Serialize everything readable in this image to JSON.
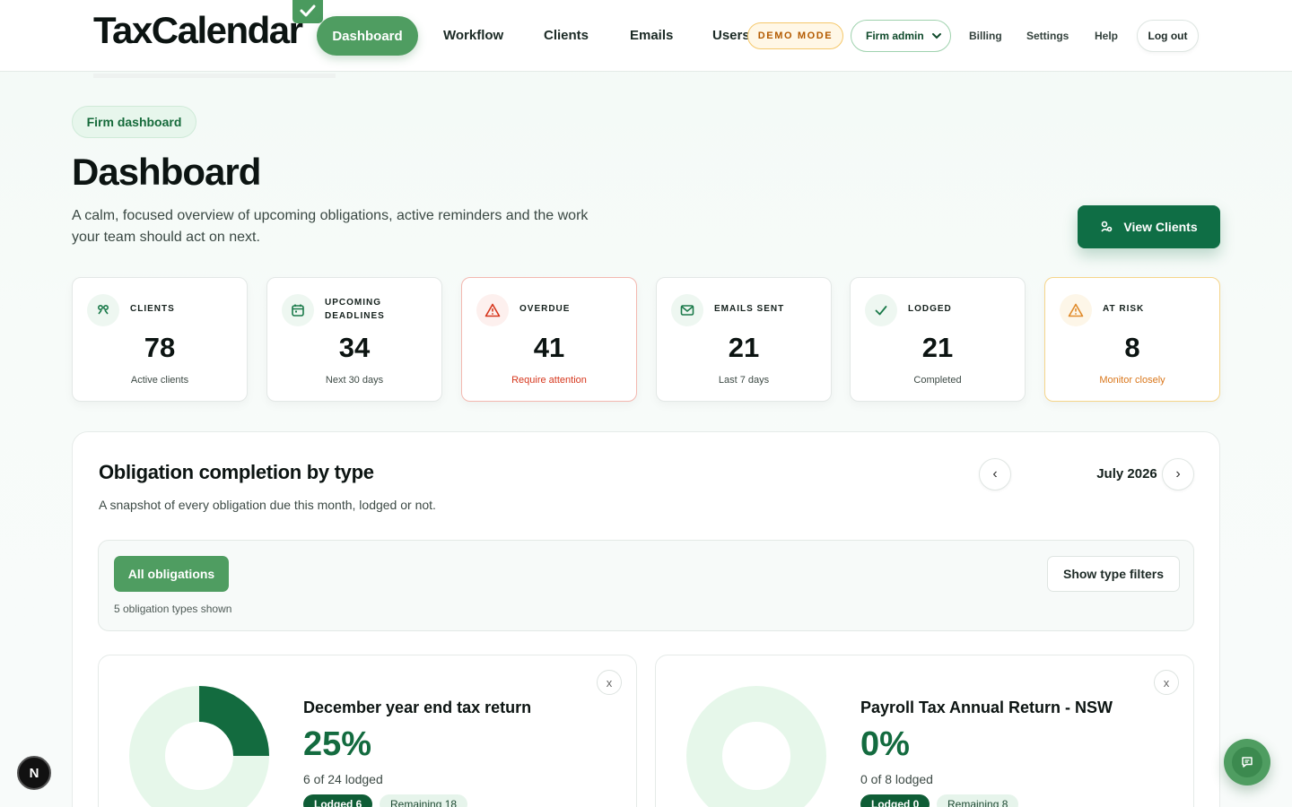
{
  "header": {
    "logo_text": "TaxCalendar",
    "nav": [
      "Dashboard",
      "Workflow",
      "Clients",
      "Emails",
      "Users"
    ],
    "active_nav": "Dashboard",
    "demo_badge": "DEMO MODE",
    "role_select": "Firm admin",
    "links": [
      "Billing",
      "Settings",
      "Help"
    ],
    "logout": "Log out"
  },
  "page": {
    "breadcrumb": "Firm dashboard",
    "title": "Dashboard",
    "subtitle": "A calm, focused overview of upcoming obligations, active reminders and the work your team should act on next.",
    "primary_action": "View Clients"
  },
  "stats": [
    {
      "label": "CLIENTS",
      "value": "78",
      "caption": "Active clients",
      "icon": "clients-icon",
      "tone": "normal"
    },
    {
      "label": "UPCOMING DEADLINES",
      "value": "34",
      "caption": "Next 30 days",
      "icon": "calendar-icon",
      "tone": "normal"
    },
    {
      "label": "OVERDUE",
      "value": "41",
      "caption": "Require attention",
      "icon": "alert-icon",
      "tone": "danger"
    },
    {
      "label": "EMAILS SENT",
      "value": "21",
      "caption": "Last 7 days",
      "icon": "mail-icon",
      "tone": "normal"
    },
    {
      "label": "LODGED",
      "value": "21",
      "caption": "Completed",
      "icon": "check-icon",
      "tone": "normal"
    },
    {
      "label": "AT RISK",
      "value": "8",
      "caption": "Monitor closely",
      "icon": "warning-icon",
      "tone": "warn"
    }
  ],
  "obligations": {
    "title": "Obligation completion by type",
    "subtitle": "A snapshot of every obligation due this month, lodged or not.",
    "month": "July 2026",
    "prev": "‹",
    "next": "›",
    "filter_all": "All obligations",
    "filter_toggle": "Show type filters",
    "types_shown": "5 obligation types shown",
    "cards": [
      {
        "name": "December year end tax return",
        "percent": "25%",
        "count_text": "6 of 24 lodged",
        "lodged_tag": "Lodged 6",
        "remaining_tag": "Remaining 18",
        "lodged": 6,
        "total": 24,
        "close": "x"
      },
      {
        "name": "Payroll Tax Annual Return - NSW",
        "percent": "0%",
        "count_text": "0 of 8 lodged",
        "lodged_tag": "Lodged 0",
        "remaining_tag": "Remaining 8",
        "lodged": 0,
        "total": 8,
        "close": "x"
      }
    ]
  },
  "floating": {
    "next_badge": "N",
    "chat_icon": "chat-icon"
  },
  "colors": {
    "primary": "#4f9d61",
    "dark_green": "#0f6e45",
    "danger": "#d6361c",
    "warn": "#d9761a"
  }
}
